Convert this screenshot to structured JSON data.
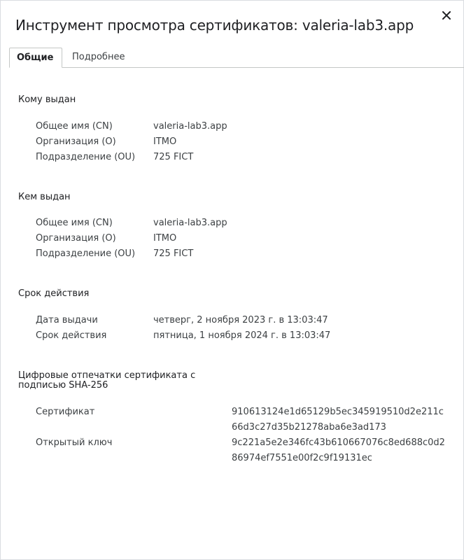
{
  "dialog": {
    "title": "Инструмент просмотра сертификатов: valeria-lab3.app",
    "close_icon": "close-icon"
  },
  "tabs": [
    {
      "label": "Общие",
      "active": true
    },
    {
      "label": "Подробнее",
      "active": false
    }
  ],
  "issued_to": {
    "title": "Кому выдан",
    "cn_label": "Общее имя (CN)",
    "cn_value": "valeria-lab3.app",
    "o_label": "Организация (O)",
    "o_value": "ITMO",
    "ou_label": "Подразделение (OU)",
    "ou_value": "725 FICT"
  },
  "issued_by": {
    "title": "Кем выдан",
    "cn_label": "Общее имя (CN)",
    "cn_value": "valeria-lab3.app",
    "o_label": "Организация (O)",
    "o_value": "ITMO",
    "ou_label": "Подразделение (OU)",
    "ou_value": "725 FICT"
  },
  "validity": {
    "title": "Срок действия",
    "issued_label": "Дата выдачи",
    "issued_value": "четверг, 2 ноября 2023 г. в 13:03:47",
    "expires_label": "Срок действия",
    "expires_value": "пятница, 1 ноября 2024 г. в 13:03:47"
  },
  "fingerprints": {
    "title_line1": "Цифровые отпечатки сертификата с",
    "title_line2": "подписью SHA-256",
    "cert_label": "Сертификат",
    "cert_value": "910613124e1d65129b5ec345919510d2e211c66d3c27d35b21278aba6e3ad173",
    "key_label": "Открытый ключ",
    "key_value": "9c221a5e2e346fc43b610667076c8ed688c0d286974ef7551e00f2c9f19131ec"
  }
}
